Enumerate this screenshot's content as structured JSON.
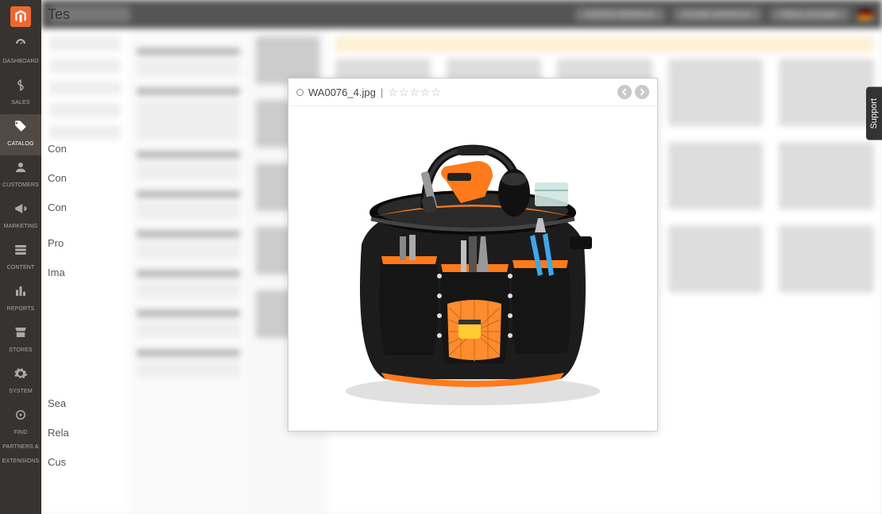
{
  "page_title_peek": "Tes",
  "sidebar": {
    "items": [
      {
        "label": "DASHBOARD"
      },
      {
        "label": "SALES"
      },
      {
        "label": "CATALOG"
      },
      {
        "label": "CUSTOMERS"
      },
      {
        "label": "MARKETING"
      },
      {
        "label": "CONTENT"
      },
      {
        "label": "REPORTS"
      },
      {
        "label": "STORES"
      },
      {
        "label": "SYSTEM"
      },
      {
        "label": "FIND PARTNERS & EXTENSIONS"
      }
    ]
  },
  "topbar": {
    "brand": "tessa",
    "buttons": [
      "Geführte Webdemo",
      "Kontakt aufnehmen",
      "Videos anzeigen"
    ]
  },
  "peek_rows": [
    "Con",
    "Con",
    "Con",
    "Pro",
    "Ima",
    "Sea",
    "Rela",
    "Cus"
  ],
  "support_tab": "Support",
  "lightbox": {
    "filename": "WA0076_4.jpg",
    "separator": "|",
    "stars": "☆☆☆☆☆",
    "nav_prev_icon": "chevron-left",
    "nav_next_icon": "chevron-right"
  }
}
